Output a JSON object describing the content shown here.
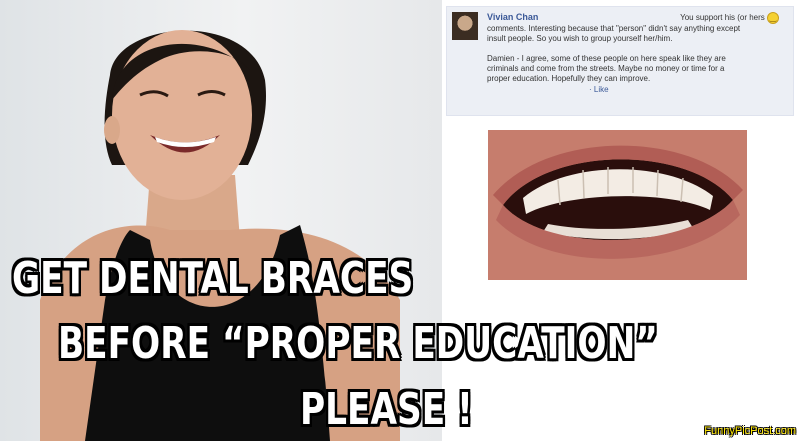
{
  "comment": {
    "author": "Vivian Chan",
    "first_line": "You support his (or hers",
    "smiley": "🙂",
    "line2": "comments. Interesting because that \"person\" didn't say anything except",
    "line3": "insult people. So you wish to group yourself her/him.",
    "para2_line1": "Damien - I agree, some of these people on here speak like they are",
    "para2_line2": "criminals and come from the streets. Maybe no money or time for a",
    "para2_line3": "proper education. Hopefully they can improve.",
    "like_label": "· Like"
  },
  "caption": {
    "line1": "GET DENTAL BRACES",
    "line2": "BEFORE “PROPER EDUCATION”",
    "line3": "PLEASE !"
  },
  "watermark": "FunnyPicPost.com",
  "colors": {
    "fb_link": "#3b5998",
    "fb_bg": "#eceff5",
    "caption_fill": "#ffffff",
    "caption_stroke": "#000000",
    "watermark": "#ffe600"
  }
}
